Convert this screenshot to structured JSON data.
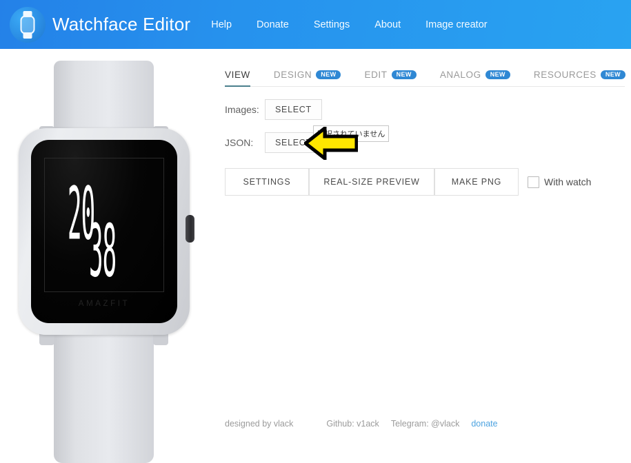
{
  "header": {
    "logo_icon": "watch-logo-icon",
    "title": "Watchface Editor",
    "nav": [
      {
        "label": "Help"
      },
      {
        "label": "Donate"
      },
      {
        "label": "Settings"
      },
      {
        "label": "About"
      },
      {
        "label": "Image creator"
      }
    ],
    "gradient_from": "#2481e8",
    "gradient_to": "#29a3f1"
  },
  "preview": {
    "device_brand": "AMAZFIT",
    "watchface": {
      "hours": "20",
      "minutes": "38",
      "digit_color": "#ffffff",
      "screen_color": "#000000"
    },
    "case_color": "#e5e7ea",
    "strap_color": "#dfe1e5"
  },
  "main": {
    "tabs": [
      {
        "label": "VIEW",
        "active": true,
        "badge": ""
      },
      {
        "label": "DESIGN",
        "active": false,
        "badge": "NEW"
      },
      {
        "label": "EDIT",
        "active": false,
        "badge": "NEW"
      },
      {
        "label": "ANALOG",
        "active": false,
        "badge": "NEW"
      },
      {
        "label": "RESOURCES",
        "active": false,
        "badge": "NEW"
      }
    ],
    "tab_active_color": "#4a7f8c",
    "badge_color": "#2f88d4",
    "images_row": {
      "label": "Images:",
      "select_label": "SELECT"
    },
    "json_row": {
      "label": "JSON:",
      "select_label": "SELECT",
      "status_text": "選択されていません"
    },
    "actions": {
      "settings_label": "SETTINGS",
      "preview_label": "REAL-SIZE PREVIEW",
      "make_png_label": "MAKE PNG",
      "with_watch_label": "With watch",
      "with_watch_checked": false
    },
    "annotation": {
      "icon": "left-arrow-pointer",
      "fill": "#ffe600",
      "stroke": "#000000"
    }
  },
  "footer": {
    "designed_by": "designed by vlack",
    "github": "Github: v1ack",
    "telegram": "Telegram: @vlack",
    "donate_label": "donate",
    "link_color": "#4da3e0"
  }
}
